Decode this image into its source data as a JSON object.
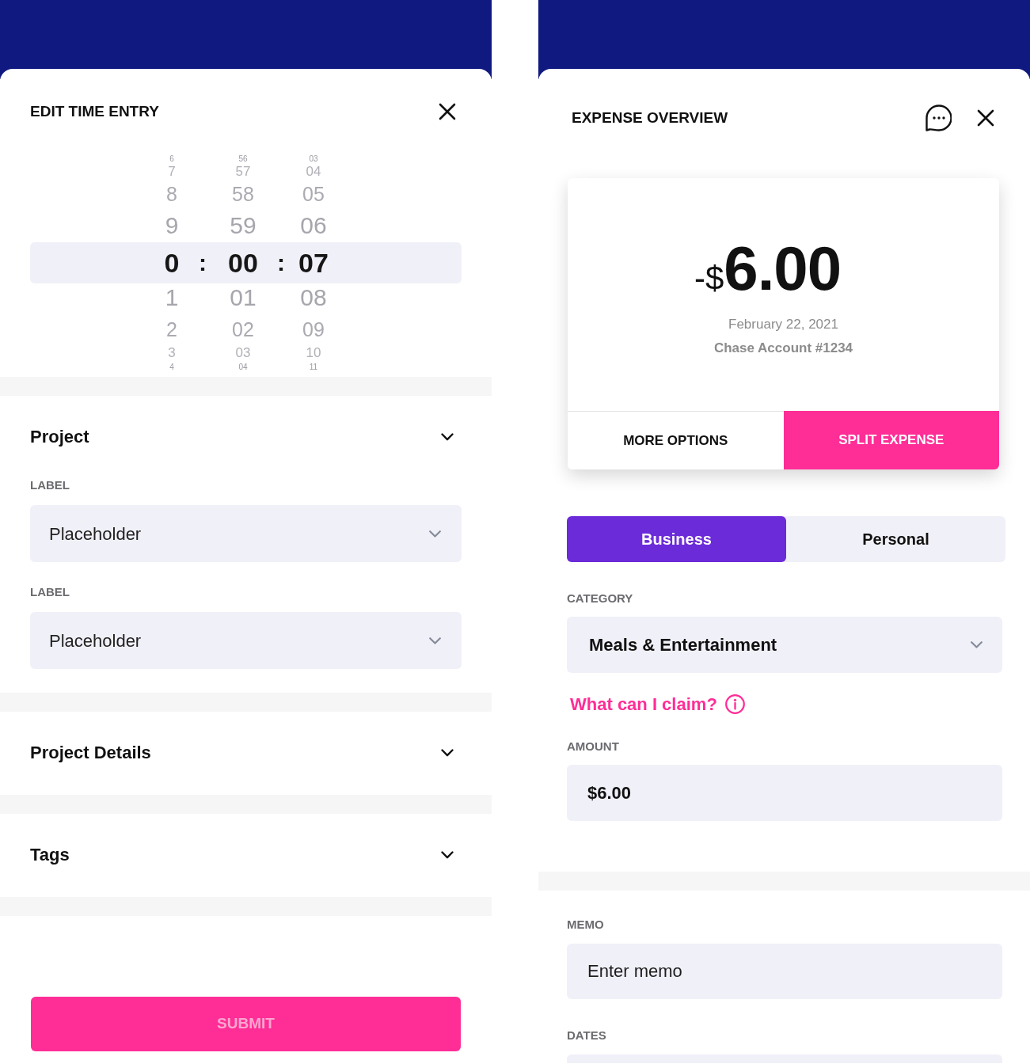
{
  "edit_time_entry": {
    "title": "EDIT TIME ENTRY",
    "time_picker": {
      "columns": [
        {
          "items": [
            {
              "text": "6",
              "selected": false
            },
            {
              "text": "7",
              "selected": false
            },
            {
              "text": "8",
              "selected": false
            },
            {
              "text": "9",
              "selected": false
            },
            {
              "text": "0",
              "selected": true
            },
            {
              "text": "1",
              "selected": false
            },
            {
              "text": "2",
              "selected": false
            },
            {
              "text": "3",
              "selected": false
            },
            {
              "text": "4",
              "selected": false
            }
          ]
        },
        {
          "items": [
            {
              "text": "56",
              "selected": false
            },
            {
              "text": "57",
              "selected": false
            },
            {
              "text": "58",
              "selected": false
            },
            {
              "text": "59",
              "selected": false
            },
            {
              "text": "00",
              "selected": true
            },
            {
              "text": "01",
              "selected": false
            },
            {
              "text": "02",
              "selected": false
            },
            {
              "text": "03",
              "selected": false
            },
            {
              "text": "04",
              "selected": false
            }
          ]
        },
        {
          "items": [
            {
              "text": "03",
              "selected": false
            },
            {
              "text": "04",
              "selected": false
            },
            {
              "text": "05",
              "selected": false
            },
            {
              "text": "06",
              "selected": false
            },
            {
              "text": "07",
              "selected": true
            },
            {
              "text": "08",
              "selected": false
            },
            {
              "text": "09",
              "selected": false
            },
            {
              "text": "10",
              "selected": false
            },
            {
              "text": "11",
              "selected": false
            }
          ]
        }
      ],
      "separators": [
        ":",
        ":"
      ]
    },
    "sections": [
      {
        "title": "Project",
        "fields": [
          {
            "label": "LABEL",
            "placeholder": "Placeholder"
          },
          {
            "label": "LABEL",
            "placeholder": "Placeholder"
          }
        ]
      },
      {
        "title": "Project Details"
      },
      {
        "title": "Tags"
      }
    ],
    "submit": {
      "label": "SUBMIT",
      "disabled": true
    }
  },
  "expense_overview": {
    "title": "EXPENSE OVERVIEW",
    "summary": {
      "prefix": "-$",
      "amount": "6.00",
      "date": "February 22, 2021",
      "account": "Chase Account #1234"
    },
    "actions": [
      {
        "label": "MORE OPTIONS",
        "kind": "secondary"
      },
      {
        "label": "SPLIT EXPENSE",
        "kind": "primary"
      }
    ],
    "type_toggle": [
      {
        "label": "Business",
        "selected": true
      },
      {
        "label": "Personal",
        "selected": false
      }
    ],
    "category": {
      "label": "CATEGORY",
      "value": "Meals & Entertainment"
    },
    "help_link": "What can I claim?",
    "amount": {
      "label": "AMOUNT",
      "value": "$6.00"
    },
    "memo": {
      "label": "MEMO",
      "placeholder": "Enter memo"
    },
    "dates": {
      "label": "DATES"
    }
  }
}
